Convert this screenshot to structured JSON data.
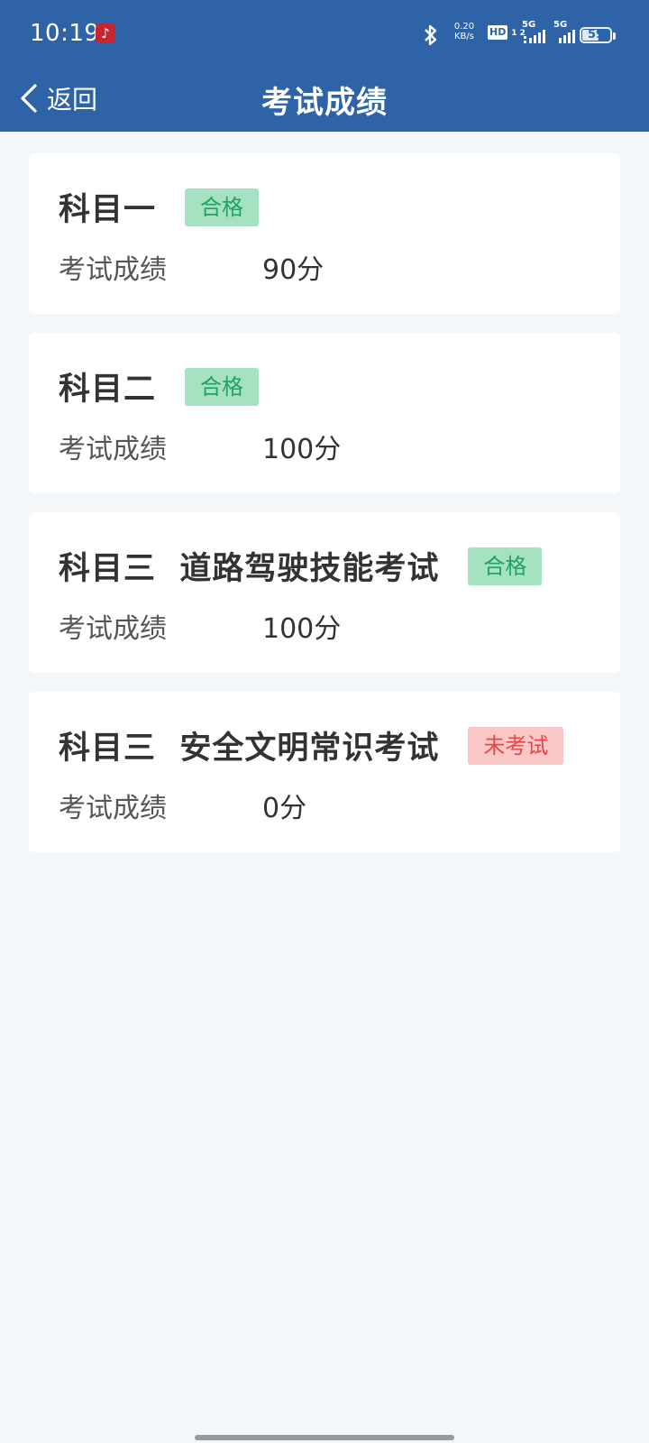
{
  "status_bar": {
    "time": "10:19",
    "app_notification_icon": "netease-music-icon",
    "net_speed_value": "0.20",
    "net_speed_unit": "KB/s",
    "hd_label": "HD",
    "hd_sub": "1 2",
    "signal1_label": "5G",
    "signal2_label": "5G",
    "battery_level": "59"
  },
  "nav": {
    "back_label": "返回",
    "title": "考试成绩"
  },
  "colors": {
    "header_bg": "#2f63a8",
    "pass_bg": "#a5e2c2",
    "pass_text": "#22a263",
    "fail_bg": "#fbc8c8",
    "fail_text": "#e54848"
  },
  "exams": [
    {
      "title": "科目一",
      "status": "合格",
      "status_type": "pass",
      "score_label": "考试成绩",
      "score": "90分"
    },
    {
      "title": "科目二",
      "status": "合格",
      "status_type": "pass",
      "score_label": "考试成绩",
      "score": "100分"
    },
    {
      "title": "科目三  道路驾驶技能考试",
      "status": "合格",
      "status_type": "pass",
      "score_label": "考试成绩",
      "score": "100分"
    },
    {
      "title": "科目三  安全文明常识考试",
      "status": "未考试",
      "status_type": "fail",
      "score_label": "考试成绩",
      "score": "0分"
    }
  ]
}
